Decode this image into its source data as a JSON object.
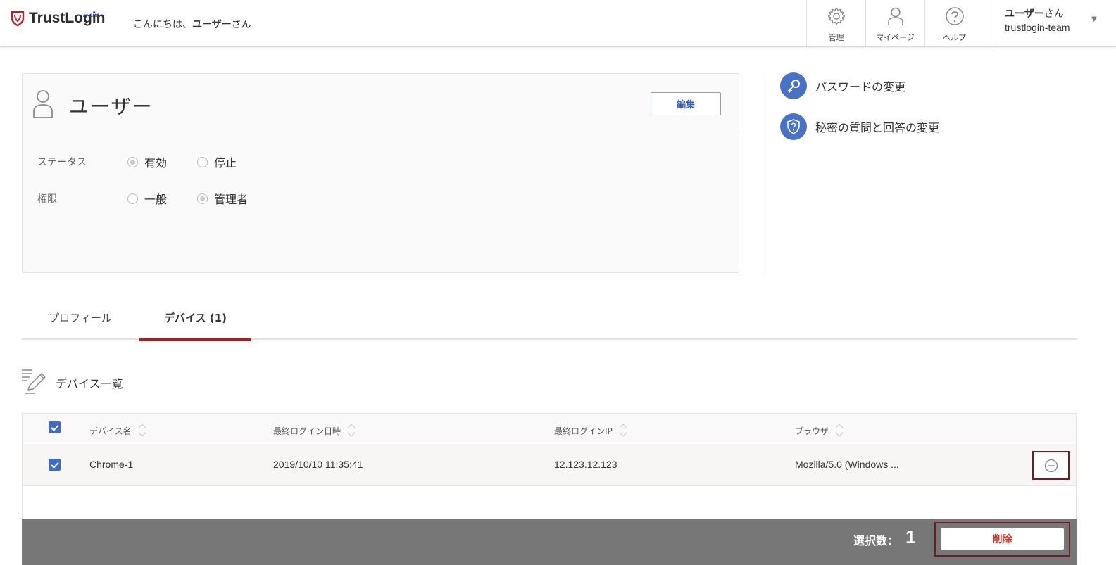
{
  "header": {
    "logo_text": "TrustLogin",
    "logo_sub": "by GMO",
    "greeting_prefix": "こんにちは、",
    "greeting_name": "ユーザー",
    "greeting_suffix": "さん",
    "nav": [
      {
        "label": "管理",
        "icon": "gear-icon"
      },
      {
        "label": "マイページ",
        "icon": "person-icon"
      },
      {
        "label": "ヘルプ",
        "icon": "help-icon"
      }
    ],
    "user": {
      "name": "ユーザー",
      "name_suffix": "さん",
      "team": "trustlogin-team"
    }
  },
  "card": {
    "title": "ユーザー",
    "edit_label": "編集",
    "status": {
      "label": "ステータス",
      "options": [
        "有効",
        "停止"
      ],
      "selected": "有効"
    },
    "role": {
      "label": "権限",
      "options": [
        "一般",
        "管理者"
      ],
      "selected": "管理者"
    }
  },
  "side_links": [
    {
      "label": "パスワードの変更",
      "icon": "key-icon"
    },
    {
      "label": "秘密の質問と回答の変更",
      "icon": "shield-question-icon"
    }
  ],
  "tabs": [
    {
      "label": "プロフィール",
      "active": false
    },
    {
      "label": "デバイス (1)",
      "active": true
    }
  ],
  "section": {
    "title": "デバイス一覧"
  },
  "table": {
    "columns": [
      "デバイス名",
      "最終ログイン日時",
      "最終ログインIP",
      "ブラウザ"
    ],
    "rows": [
      {
        "checked": true,
        "device": "Chrome-1",
        "last_login": "2019/10/10 11:35:41",
        "ip": "12.123.12.123",
        "browser": "Mozilla/5.0 (Windows ..."
      }
    ]
  },
  "footer": {
    "selected_label": "選択数：",
    "selected_count": "1",
    "delete_label": "削除"
  },
  "colors": {
    "accent": "#4a72c4",
    "tab_active": "#8b2a2a",
    "delete_text": "#d9372e"
  }
}
